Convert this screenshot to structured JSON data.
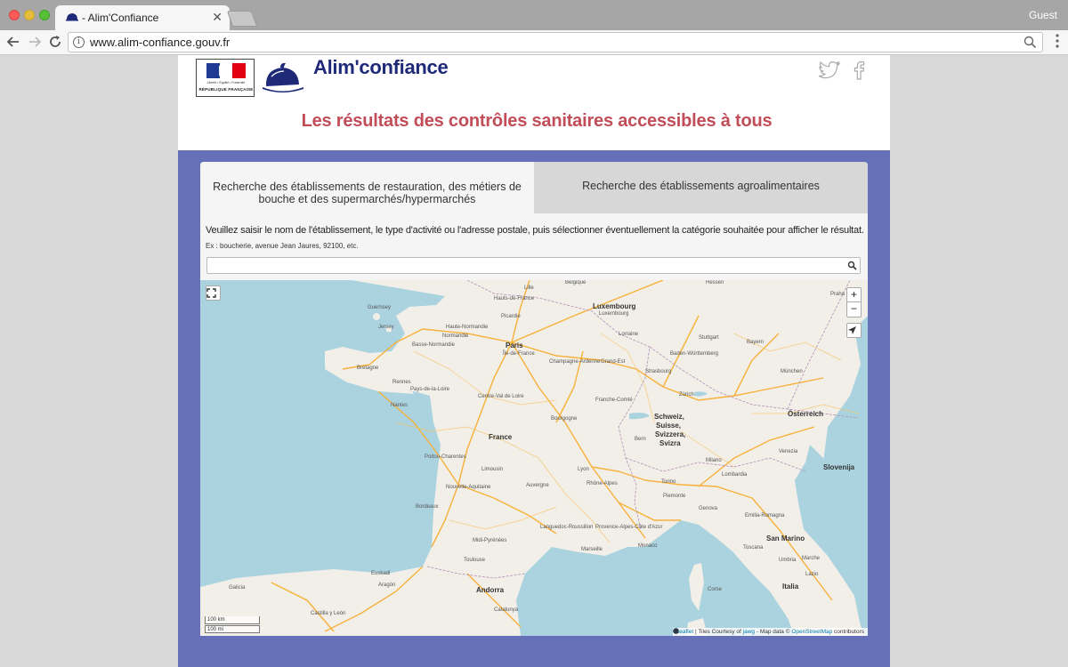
{
  "browser": {
    "tab_title": "- Alim'Confiance",
    "tab_close": "✕",
    "profile": "Guest",
    "url": "www.alim-confiance.gouv.fr"
  },
  "header": {
    "rf_motto": "Liberté • Égalité • Fraternité",
    "rf_name": "RÉPUBLIQUE FRANÇAISE",
    "brand": "Alim'confiance",
    "tagline": "Les résultats des contrôles sanitaires accessibles à tous"
  },
  "tabs": [
    {
      "label": "Recherche des établissements de restauration, des métiers de bouche et des supermarchés/hypermarchés"
    },
    {
      "label": "Recherche des établissements agroalimentaires"
    }
  ],
  "search": {
    "instruction": "Veuillez saisir le nom de l'établissement, le type d'activité ou l'adresse postale, puis sélectionner éventuellement la catégorie souhaitée pour afficher le résultat.",
    "example": "Ex : boucherie, avenue Jean Jaures, 92100, etc.",
    "value": ""
  },
  "map": {
    "labels": {
      "guernsey": "Guernsey",
      "jersey": "Jersey",
      "basse_normandie": "Basse-Normandie",
      "haute_normandie": "Haute-Normandie",
      "normandie": "Normandie",
      "hauts_de_france": "Hauts-de-France",
      "picardie": "Picardie",
      "paris": "Paris",
      "ile_de_france": "Île-de-France",
      "bretagne": "Bretagne",
      "pays_de_la_loire": "Pays-de-la-Loire",
      "centre_val_de_loire": "Centre-Val de Loire",
      "champagne_ardenne": "Champagne-Ardenne",
      "grand_est": "Grand-Est",
      "lorraine": "Lorraine",
      "luxembourg1": "Luxembourg",
      "luxembourg2": "Luxembourg",
      "belgique": "Belgique",
      "france": "France",
      "bourgogne": "Bourgogne",
      "franche_comte": "Franche-Comté",
      "poitou_charentes": "Poitou-Charentes",
      "limousin": "Limousin",
      "auvergne": "Auvergne",
      "nouvelle_aquitaine": "Nouvelle-Aquitaine",
      "rhone_alpes": "Rhône-Alpes",
      "midi_pyrenees": "Midi-Pyrénées",
      "languedoc": "Languedoc-Roussillon",
      "provence": "Provence-Alpes-Côte d'Azur",
      "monaco": "Monaco",
      "andorra": "Andorra",
      "aragon": "Aragón",
      "euskadi": "Euskadi",
      "galicia": "Galicia",
      "castilla": "Castilla y León",
      "catalunya": "Catalunya",
      "schweiz": "Schweiz,",
      "suisse": "Suisse,",
      "svizzera": "Svizzera,",
      "svizra": "Svizra",
      "baden": "Baden-Württemberg",
      "bayern": "Bayern",
      "osterreich": "Österreich",
      "slovenija": "Slovenija",
      "lombardia": "Lombardia",
      "piemonte": "Piemonte",
      "emilia": "Emilia-Romagna",
      "toscana": "Toscana",
      "umbria": "Umbria",
      "italia": "Italia",
      "san_marino": "San Marino",
      "corse": "Corse",
      "marche": "Marche",
      "lazio": "Lazio",
      "hessen": "Hessen",
      "praha": "Praha",
      "stuttgart": "Stuttgart",
      "munchen": "München",
      "zurich": "Zürich",
      "bern": "Bern",
      "milano": "Milano",
      "torino": "Torino",
      "venezia": "Venezia",
      "genova": "Genova",
      "lyon": "Lyon",
      "bordeaux": "Bordeaux",
      "toulouse": "Toulouse",
      "marseille": "Marseille",
      "nantes": "Nantes",
      "rennes": "Rennes",
      "lille": "Lille",
      "strasbourg": "Strasbourg"
    },
    "zoom_in": "+",
    "zoom_out": "−",
    "scale_km": "100 km",
    "scale_mi": "100 mi",
    "attr_leaflet": "Leaflet",
    "attr_tiles": " | Tiles Courtesy of ",
    "attr_jawg": "jawg",
    "attr_mapdata": " - Map data © ",
    "attr_osm": "OpenStreetMap",
    "attr_contrib": " contributors",
    "colors": {
      "water": "#aad3df",
      "land": "#f2efe9",
      "roads": "#f7b13a"
    }
  }
}
